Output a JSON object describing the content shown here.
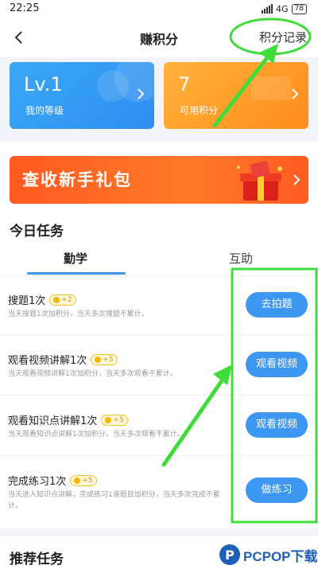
{
  "status_bar": {
    "time": "22:25",
    "network": "4G",
    "battery": "78"
  },
  "nav": {
    "title": "赚积分",
    "action": "积分记录"
  },
  "cards": {
    "level": {
      "value": "Lv.1",
      "label": "我的等级"
    },
    "points": {
      "value": "7",
      "label": "可用积分"
    }
  },
  "banner": {
    "text": "查收新手礼包"
  },
  "today": {
    "title": "今日任务",
    "tabs": [
      {
        "label": "勤学",
        "active": true
      },
      {
        "label": "互助",
        "active": false
      }
    ],
    "tasks": [
      {
        "title": "搜题1次",
        "badge": "+2",
        "desc": "当天搜题1次加积分，当天多次搜题不累计。",
        "button": "去拍题"
      },
      {
        "title": "观看视频讲解1次",
        "badge": "+5",
        "desc": "当天观看视频讲解1次加积分，当天多次观看不累计。",
        "button": "观看视频"
      },
      {
        "title": "观看知识点讲解1次",
        "badge": "+5",
        "desc": "当天观看知识点讲解1次加积分，当天多次观看不累计。",
        "button": "观看视频"
      },
      {
        "title": "完成练习1次",
        "badge": "+5",
        "desc": "当天进入知识点讲解，完成练习1道题目加积分，当天多次完成不累计。",
        "button": "做练习"
      }
    ]
  },
  "recommended": {
    "title": "推荐任务"
  },
  "watermark": {
    "text": "PCPOP下载"
  },
  "colors": {
    "accent": "#3c97f3",
    "annotation": "#3fdc3a",
    "banner": "#ff6a22"
  }
}
